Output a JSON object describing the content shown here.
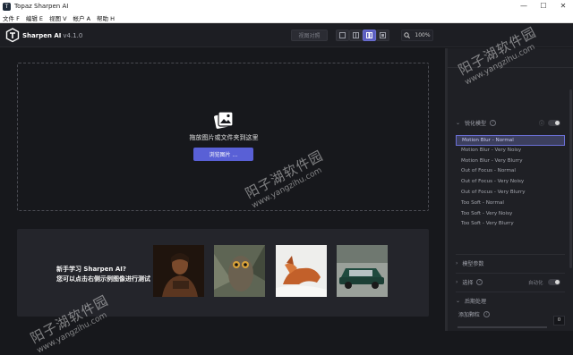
{
  "window": {
    "title": "Topaz Sharpen AI",
    "app_icon": "T",
    "min": "—",
    "max": "☐",
    "close": "✕"
  },
  "menu": [
    "文件 F",
    "编辑 E",
    "视图 V",
    "帐户 A",
    "帮助 H"
  ],
  "toolbar": {
    "brand": "Sharpen AI",
    "version": "v4.1.0",
    "compare": "视图对照",
    "zoom": "100%"
  },
  "dropzone": {
    "text": "拖放图片或文件夹到这里",
    "browse": "浏览图片 ..."
  },
  "samples": {
    "line1": "新手学习 Sharpen AI?",
    "line2": "您可以点击右侧示例图像进行测试"
  },
  "panel": {
    "model_title": "锐化模型",
    "models": [
      "Motion Blur - Normal",
      "Motion Blur - Very Noisy",
      "Motion Blur - Very Blurry",
      "Out of Focus - Normal",
      "Out of Focus - Very Noisy",
      "Out of Focus - Very Blurry",
      "Too Soft - Normal",
      "Too Soft - Very Noisy",
      "Too Soft - Very Blurry"
    ],
    "selected_index": 0,
    "params_title": "模型参数",
    "select_label": "选择",
    "select_auto": "自动化",
    "post_title": "后期处理",
    "grain_label": "添加颗粒",
    "grain_value": "0"
  },
  "watermark": {
    "cn": "阳子湖软件园",
    "url": "www.yangzihu.com"
  },
  "colors": {
    "accent": "#5960d6",
    "background": "#17181c",
    "panel": "#1f2025"
  }
}
